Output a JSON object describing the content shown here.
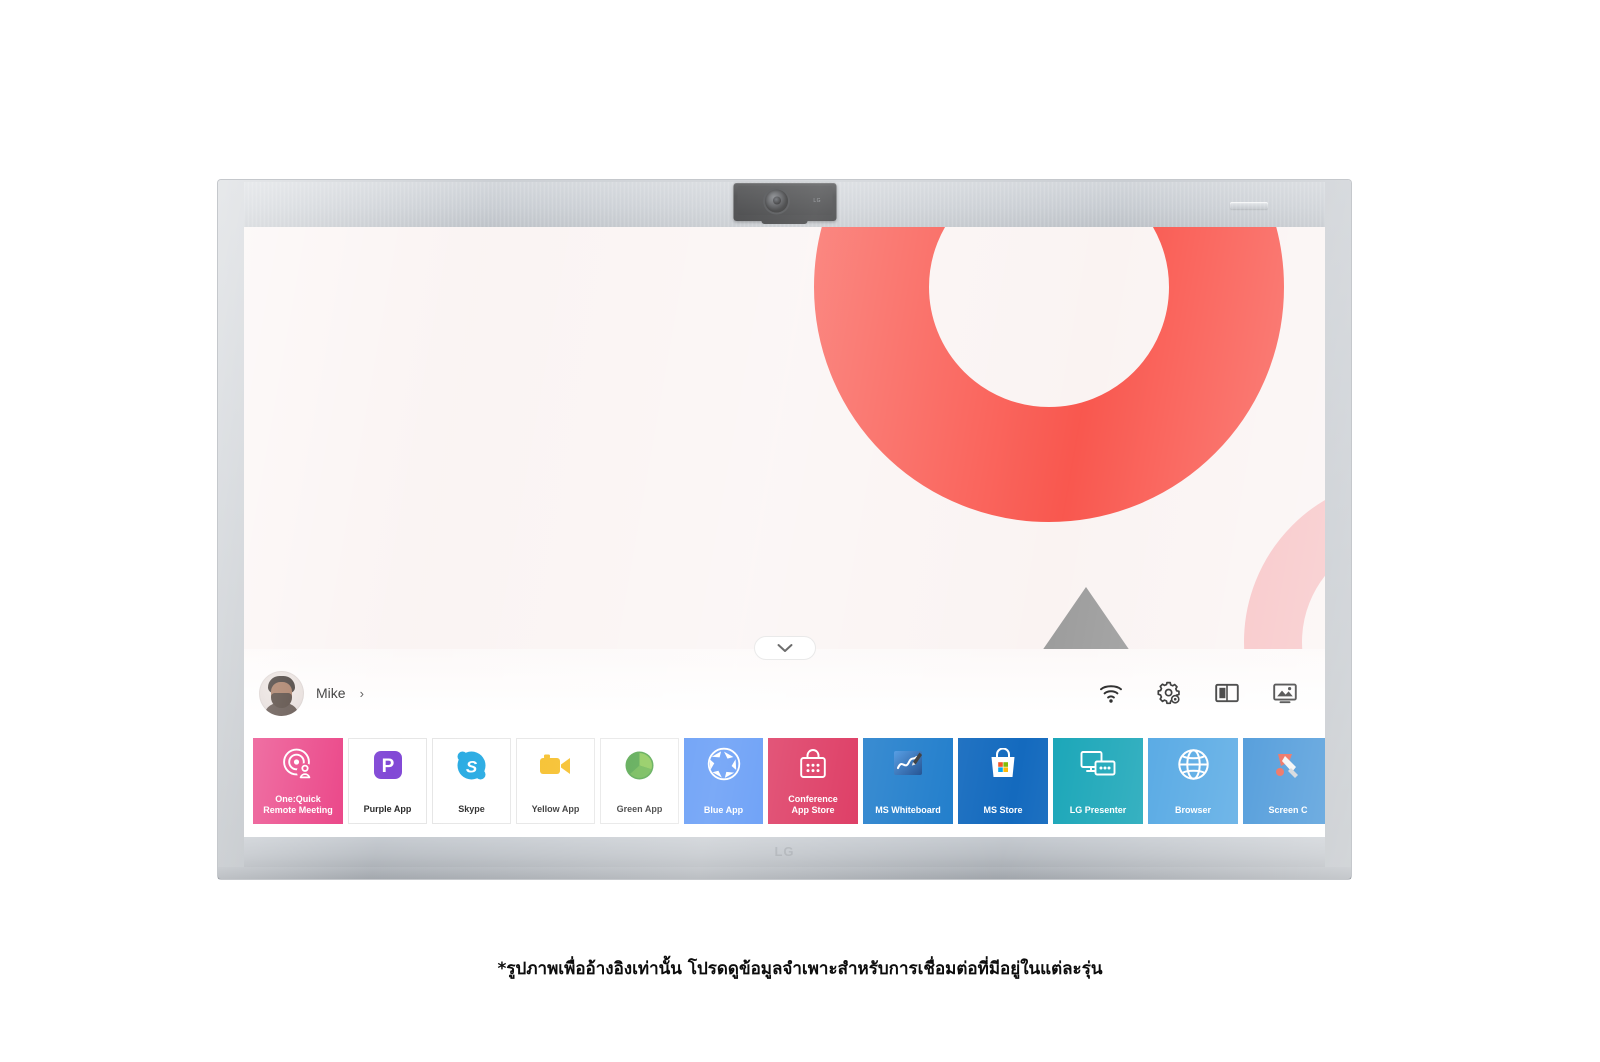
{
  "device": {
    "brand_logo": "LG",
    "camera": {
      "label": "camera-module",
      "brand_text": "LG"
    }
  },
  "launcher": {
    "handle_icon": "chevron-down-icon",
    "user": {
      "name": "Mike",
      "chevron": "›",
      "avatar_alt": "user-avatar"
    },
    "toolbar_icons": [
      {
        "name": "wifi-icon"
      },
      {
        "name": "settings-gear-icon"
      },
      {
        "name": "split-screen-icon"
      },
      {
        "name": "screen-image-icon"
      }
    ],
    "tiles": [
      {
        "label": "One:Quick\nRemote Meeting",
        "icon": "one-quick-remote-meeting-icon",
        "bg": "#e8307a",
        "style": "dark"
      },
      {
        "label": "Purple App",
        "icon": "purple-app-icon",
        "bg": "#ffffff",
        "style": "light"
      },
      {
        "label": "Skype",
        "icon": "skype-icon",
        "bg": "#ffffff",
        "style": "light"
      },
      {
        "label": "Yellow App",
        "icon": "yellow-camcorder-icon",
        "bg": "#ffffff",
        "style": "light"
      },
      {
        "label": "Green App",
        "icon": "green-app-icon",
        "bg": "#ffffff",
        "style": "light"
      },
      {
        "label": "Blue App",
        "icon": "aperture-icon",
        "bg": "#4285f4",
        "style": "dark"
      },
      {
        "label": "Conference\nApp Store",
        "icon": "shopping-bag-icon",
        "bg": "#d81b4a",
        "style": "dark"
      },
      {
        "label": "MS Whiteboard",
        "icon": "ms-whiteboard-icon",
        "bg": "#1275c8",
        "style": "dark"
      },
      {
        "label": "MS Store",
        "icon": "ms-store-icon",
        "bg": "#0f67bd",
        "style": "dark"
      },
      {
        "label": "LG Presenter",
        "icon": "lg-presenter-icon",
        "bg": "#10a2b5",
        "style": "dark"
      },
      {
        "label": "Browser",
        "icon": "globe-icon",
        "bg": "#3d9ce0",
        "style": "dark"
      },
      {
        "label": "Screen C",
        "icon": "screen-capture-icon",
        "bg": "#1f7fd0",
        "style": "dark"
      }
    ]
  },
  "wallpaper": {
    "shapes": [
      {
        "name": "red-ring",
        "color": "#f9544b"
      },
      {
        "name": "pink-ring",
        "color": "#f7bec0"
      },
      {
        "name": "gray-triangle",
        "color": "#9a9a9a"
      }
    ],
    "background_color": "#faf3f2"
  },
  "footnote": {
    "text": "*รูปภาพเพื่ออ้างอิงเท่านั้น โปรดดูข้อมูลจำเพาะสำหรับการเชื่อมต่อที่มีอยู่ในแต่ละรุ่น"
  }
}
